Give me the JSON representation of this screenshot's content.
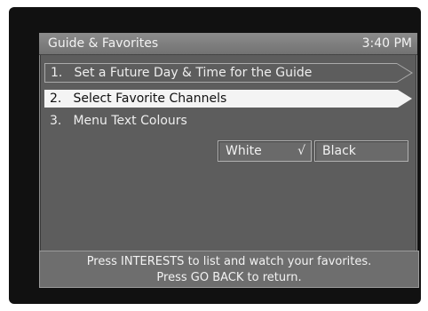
{
  "header": {
    "title": "Guide & Favorites",
    "time": "3:40 PM"
  },
  "menu": {
    "items": [
      {
        "num": "1.",
        "label": "Set a Future Day & Time for the Guide",
        "selected": false
      },
      {
        "num": "2.",
        "label": "Select Favorite Channels",
        "selected": true
      },
      {
        "num": "3.",
        "label": "Menu Text Colours",
        "selected": false
      }
    ]
  },
  "colour_options": {
    "white": {
      "label": "White",
      "checked": true,
      "check_glyph": "√"
    },
    "black": {
      "label": "Black",
      "checked": false
    }
  },
  "footer": {
    "line1": "Press INTERESTS to list and watch your favorites.",
    "line2": "Press GO BACK to return."
  },
  "colors": {
    "panel": "#5d5d5d",
    "highlight": "#f4f4f4",
    "screen_bg": "#111111"
  }
}
